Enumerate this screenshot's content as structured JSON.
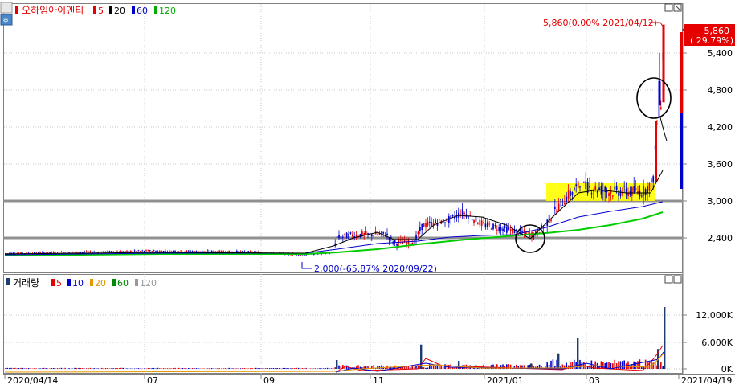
{
  "price_panel": {
    "stock_name": "오하임아이엔티",
    "ma_legend": [
      {
        "label": "5",
        "color": "#e60000"
      },
      {
        "label": "20",
        "color": "#000000"
      },
      {
        "label": "60",
        "color": "#0000cc"
      },
      {
        "label": "120",
        "color": "#00aa00"
      }
    ],
    "current_price": "5,860",
    "current_change": "( 29.79%)",
    "high_annotation": "5,860(0.00% 2021/04/12)",
    "low_annotation": "2,000(-65.87% 2020/09/22)",
    "y_ticks": [
      "5,400",
      "4,800",
      "4,200",
      "3,600",
      "3,000",
      "2,400"
    ]
  },
  "volume_panel": {
    "title": "거래량",
    "ma_legend": [
      {
        "label": "5",
        "color": "#e60000"
      },
      {
        "label": "10",
        "color": "#0000cc"
      },
      {
        "label": "20",
        "color": "#e69500"
      },
      {
        "label": "60",
        "color": "#008800"
      },
      {
        "label": "120",
        "color": "#999999"
      }
    ],
    "y_ticks": [
      "12,000K",
      "6,000K",
      "0K"
    ]
  },
  "x_axis": {
    "labels": [
      "2020/04/14",
      "07",
      "09",
      "11",
      "2021/01",
      "03",
      "2021/04/19"
    ]
  },
  "colors": {
    "up": "#e60000",
    "down": "#0000cc",
    "ma120": "#00cc00",
    "highlight": "#ffff00"
  },
  "chart_data": {
    "type": "candlestick",
    "x_range": [
      "2020/04/14",
      "2021/04/19"
    ],
    "price_ylim": [
      2000,
      6000
    ],
    "volume_ylim": [
      0,
      16000
    ],
    "price_series": [
      {
        "date": "2020/04",
        "close": 2150
      },
      {
        "date": "2020/06",
        "close": 2180
      },
      {
        "date": "2020/07",
        "close": 2200
      },
      {
        "date": "2020/08",
        "close": 2140
      },
      {
        "date": "2020/09",
        "close": 2120
      },
      {
        "date": "2020/10",
        "close": 2320
      },
      {
        "date": "2020/11",
        "close": 2450
      },
      {
        "date": "2020/12",
        "close": 2800
      },
      {
        "date": "2021/01",
        "close": 2550
      },
      {
        "date": "2021/02",
        "close": 3000
      },
      {
        "date": "2021/03",
        "close": 3200
      },
      {
        "date": "2021/04/05",
        "close": 3200
      },
      {
        "date": "2021/04/09",
        "close": 4700
      },
      {
        "date": "2021/04/12",
        "close": 5860
      }
    ],
    "high": {
      "value": 5860,
      "date": "2021/04/12",
      "change_pct": 0.0
    },
    "low": {
      "value": 2000,
      "date": "2020/09/22",
      "change_pct": -65.87
    },
    "volume_series": [
      {
        "date": "2020/10",
        "value": 2000
      },
      {
        "date": "2020/11",
        "value": 5500
      },
      {
        "date": "2020/12",
        "value": 1800
      },
      {
        "date": "2021/01",
        "value": 1200
      },
      {
        "date": "2021/02",
        "value": 3500
      },
      {
        "date": "2021/03",
        "value": 7000
      },
      {
        "date": "2021/04/09",
        "value": 4500
      },
      {
        "date": "2021/04/12",
        "value": 14000
      }
    ],
    "support_lines": [
      3000,
      2400
    ]
  }
}
